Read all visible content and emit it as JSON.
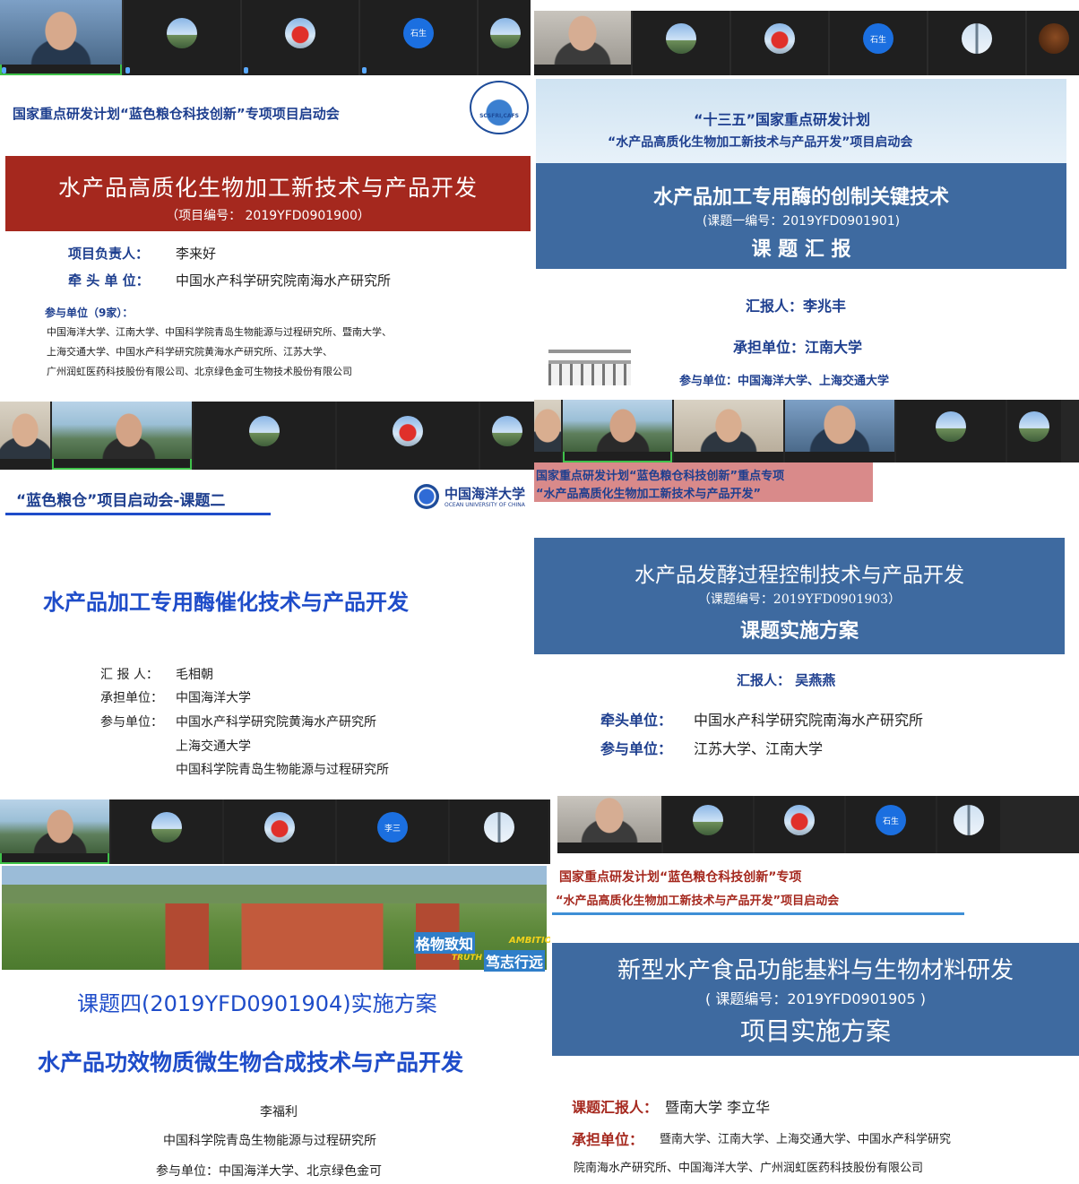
{
  "p1": {
    "header": "国家重点研发计划“蓝色粮仓科技创新”专项项目启动会",
    "logo_text": "SCSFRI,CAFS",
    "banner_title": "水产品高质化生物加工新技术与产品开发",
    "banner_code": "（项目编号： 2019YFD0901900）",
    "leader_label": "项目负责人：",
    "leader_value": "李来好",
    "lead_unit_label": "牵 头 单 位：",
    "lead_unit_value": "中国水产科学研究院南海水产研究所",
    "participants_label": "参与单位（9家）：",
    "participants_line1": "中国海洋大学、江南大学、中国科学院青岛生物能源与过程研究所、暨南大学、",
    "participants_line2": "上海交通大学、中国水产科学研究院黄海水产研究所、江苏大学、",
    "participants_line3": "广州润虹医药科技股份有限公司、北京绿色金可生物技术股份有限公司",
    "tile_badge": "石生"
  },
  "p2": {
    "header1": "“十三五”国家重点研发计划",
    "header2": "“水产品高质化生物加工新技术与产品开发”项目启动会",
    "banner_title": "水产品加工专用酶的创制关键技术",
    "banner_code": "(课题一编号：2019YFD0901901)",
    "banner_sub": "课 题 汇 报",
    "reporter": "汇报人：李兆丰",
    "unit": "承担单位：江南大学",
    "participants": "参与单位：中国海洋大学、上海交通大学",
    "tile_badge": "石生"
  },
  "p3": {
    "header": "“蓝色粮仓”项目启动会-课题二",
    "logo_cn": "中国海洋大学",
    "logo_en": "OCEAN UNIVERSITY OF CHINA",
    "title": "水产品加工专用酶催化技术与产品开发",
    "reporter_label": "汇 报 人：",
    "reporter_value": "毛相朝",
    "unit_label": "承担单位：",
    "unit_value": "中国海洋大学",
    "participants_label": "参与单位：",
    "participants_line1": "中国水产科学研究院黄海水产研究所",
    "participants_line2": "上海交通大学",
    "participants_line3": "中国科学院青岛生物能源与过程研究所"
  },
  "p4": {
    "header1": "国家重点研发计划“蓝色粮仓科技创新”重点专项",
    "header2": "“水产品高质化生物加工新技术与产品开发”",
    "banner_title": "水产品发酵过程控制技术与产品开发",
    "banner_code": "（课题编号：2019YFD0901903）",
    "banner_sub": "课题实施方案",
    "reporter": "汇报人：  吴燕燕",
    "lead_label": "牵头单位：",
    "lead_value": "中国水产科学研究院南海水产研究所",
    "participants_label": "参与单位：",
    "participants_value": "江苏大学、江南大学"
  },
  "p5": {
    "photo_text1": "格物致知",
    "photo_text2": "笃志行远",
    "photo_text3": "AMBITIO",
    "photo_text4": "TRUTH",
    "title1": "课题四(2019YFD0901904)实施方案",
    "title2": "水产品功效物质微生物合成技术与产品开发",
    "reporter": "李福利",
    "unit": "中国科学院青岛生物能源与过程研究所",
    "participants": "参与单位：中国海洋大学、北京绿色金可",
    "tile_badge": "李三"
  },
  "p6": {
    "header1": "国家重点研发计划“蓝色粮仓科技创新”专项",
    "header2": "“水产品高质化生物加工新技术与产品开发”项目启动会",
    "banner_title": "新型水产食品功能基料与生物材料研发",
    "banner_code": "( 课题编号：2019YFD0901905 )",
    "banner_sub": "项目实施方案",
    "reporter_label": "课题汇报人：",
    "reporter_value": "暨南大学 李立华",
    "unit_label": "承担单位：",
    "unit_value1": "暨南大学、江南大学、上海交通大学、中国水产科学研究",
    "unit_value2": "院南海水产研究所、中国海洋大学、广州润虹医药科技股份有限公司",
    "tile_badge": "石生"
  }
}
